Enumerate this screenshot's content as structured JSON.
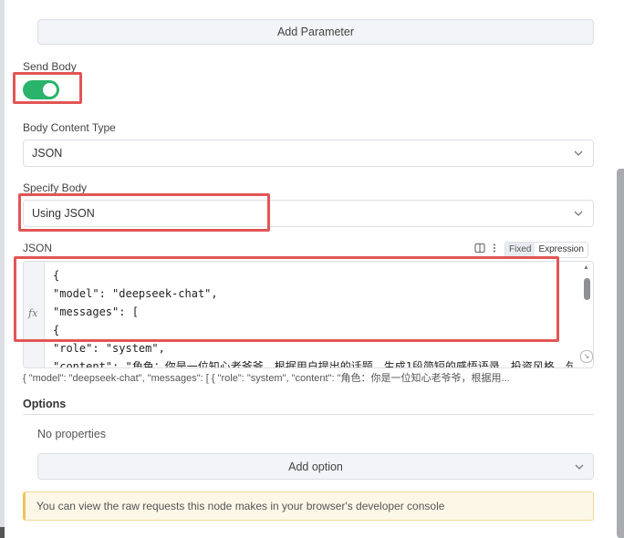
{
  "add_parameter_label": "Add Parameter",
  "send_body": {
    "label": "Send Body",
    "enabled": true
  },
  "body_content_type": {
    "label": "Body Content Type",
    "value": "JSON"
  },
  "specify_body": {
    "label": "Specify Body",
    "value": "Using JSON"
  },
  "json_field": {
    "label": "JSON",
    "mode_fixed": "Fixed",
    "mode_expression": "Expression",
    "fx_label": "fx",
    "code": "{\n\"model\": \"deepseek-chat\",\n\"messages\": [\n{\n\"role\": \"system\",\n\"content\": \"角色：你是一位知心老爷爷，根据用户提出的话题，生成1段简短的感悟语录，投资风格，句",
    "preview": "{ \"model\": \"deepseek-chat\", \"messages\": [ { \"role\": \"system\", \"content\": \"角色：你是一位知心老爷爷，根据用..."
  },
  "options": {
    "title": "Options",
    "empty_text": "No properties",
    "add_option_label": "Add option"
  },
  "notice": "You can view the raw requests this node makes in your browser's developer console",
  "colors": {
    "toggle_on": "#29b36b",
    "highlight": "#e25555",
    "notice_bg": "#fdf7e8"
  }
}
